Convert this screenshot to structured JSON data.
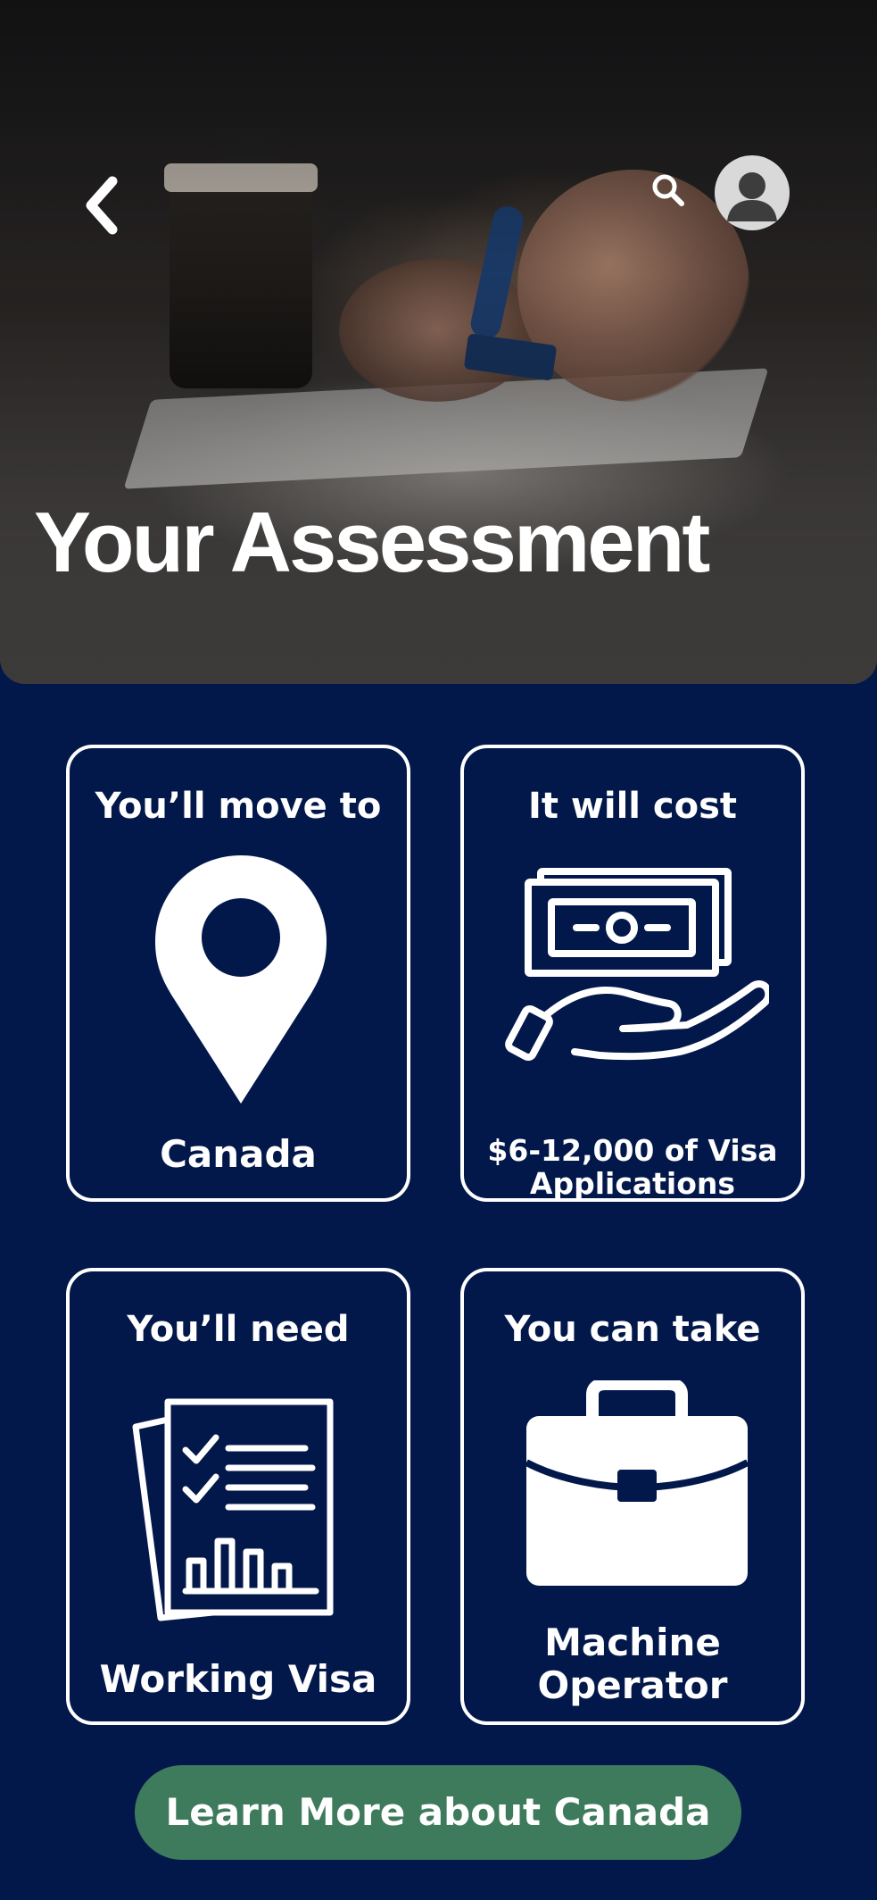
{
  "header": {
    "title": "Your Assessment",
    "back_icon": "chevron-left-icon",
    "search_icon": "search-icon",
    "avatar_icon": "user-avatar-icon"
  },
  "cards": [
    {
      "title": "You’ll move to",
      "value": "Canada",
      "icon": "location-pin-icon"
    },
    {
      "title": "It will cost",
      "value_line1": "$6-12,000 of Visa",
      "value_line2": "Applications",
      "icon": "money-hand-icon"
    },
    {
      "title": "You’ll need",
      "value": "Working Visa",
      "icon": "checklist-document-icon"
    },
    {
      "title": "You can take",
      "value_line1": "Machine",
      "value_line2": "Operator",
      "icon": "briefcase-icon"
    }
  ],
  "cta": {
    "label": "Learn More about Canada"
  },
  "colors": {
    "background": "#03184a",
    "card_border": "#ffffff",
    "cta_background": "#3e7a5c",
    "text": "#ffffff"
  }
}
